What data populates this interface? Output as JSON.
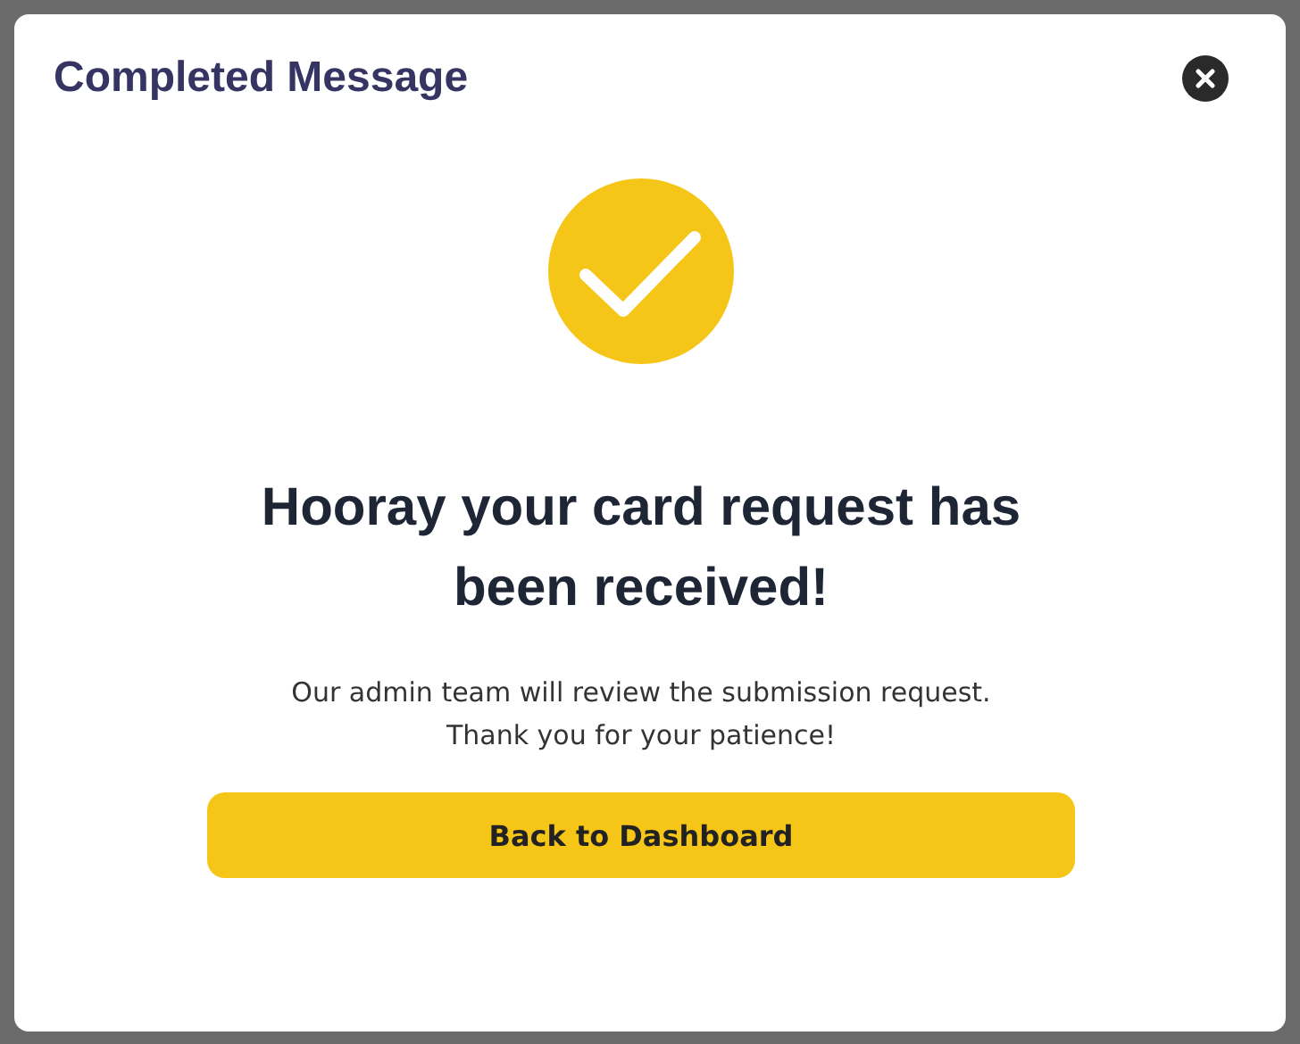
{
  "dialog": {
    "title": "Completed Message",
    "heading": "Hooray your card request has been received!",
    "message_lines": [
      "Our admin team will review the submission request.",
      "Thank you for your patience!"
    ],
    "button": "Back to Dashboard"
  }
}
